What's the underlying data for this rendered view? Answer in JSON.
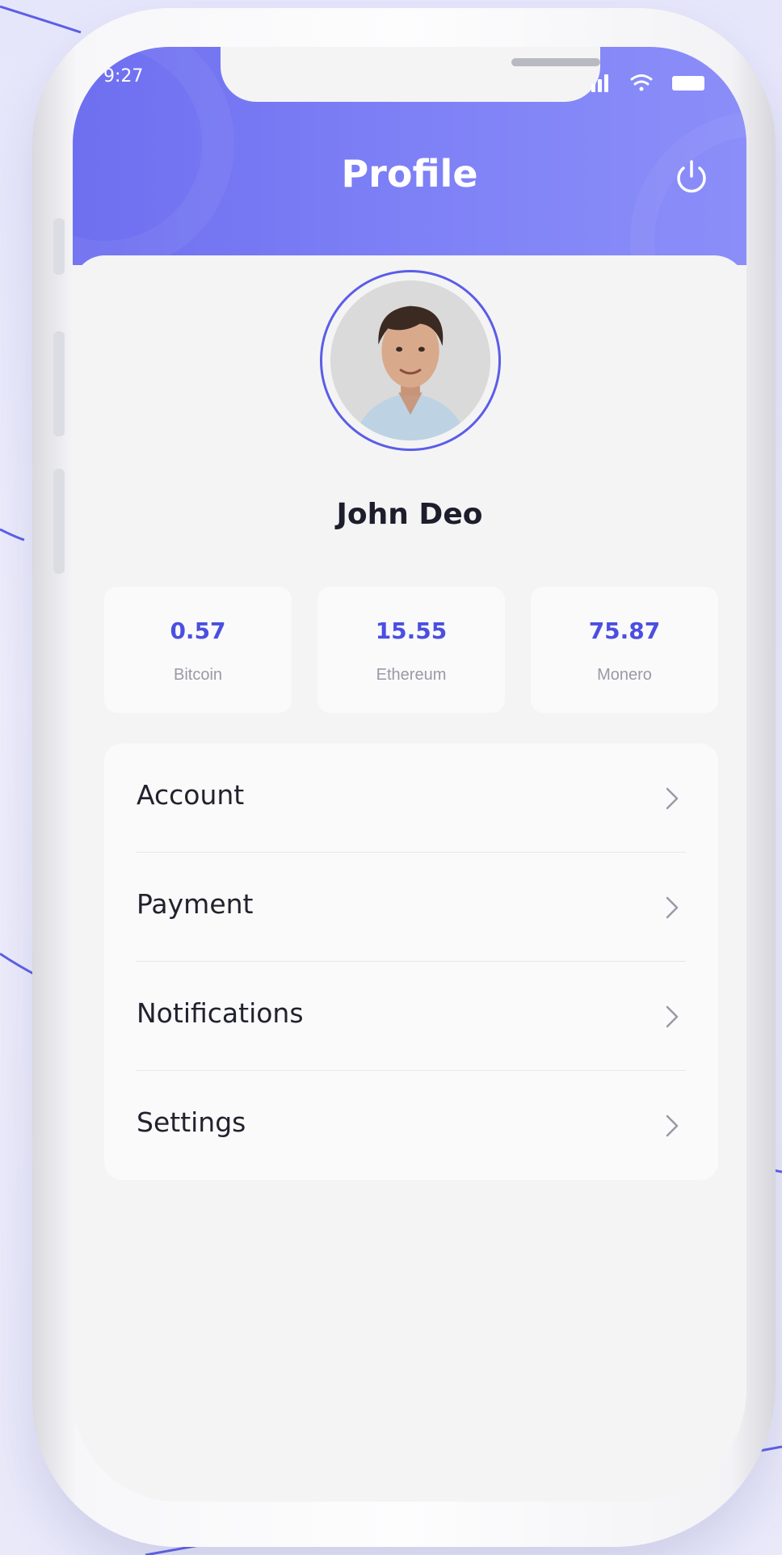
{
  "status_bar": {
    "time": "9:27"
  },
  "header": {
    "title": "Profile"
  },
  "profile": {
    "name": "John Deo"
  },
  "balances": [
    {
      "value": "0.57",
      "label": "Bitcoin"
    },
    {
      "value": "15.55",
      "label": "Ethereum"
    },
    {
      "value": "75.87",
      "label": "Monero"
    }
  ],
  "menu": {
    "items": [
      {
        "label": "Account"
      },
      {
        "label": "Payment"
      },
      {
        "label": "Notifications"
      },
      {
        "label": "Settings"
      }
    ]
  },
  "colors": {
    "accent": "#6e6ff0",
    "value_text": "#4b4fe0",
    "background": "#e9e9fa"
  }
}
